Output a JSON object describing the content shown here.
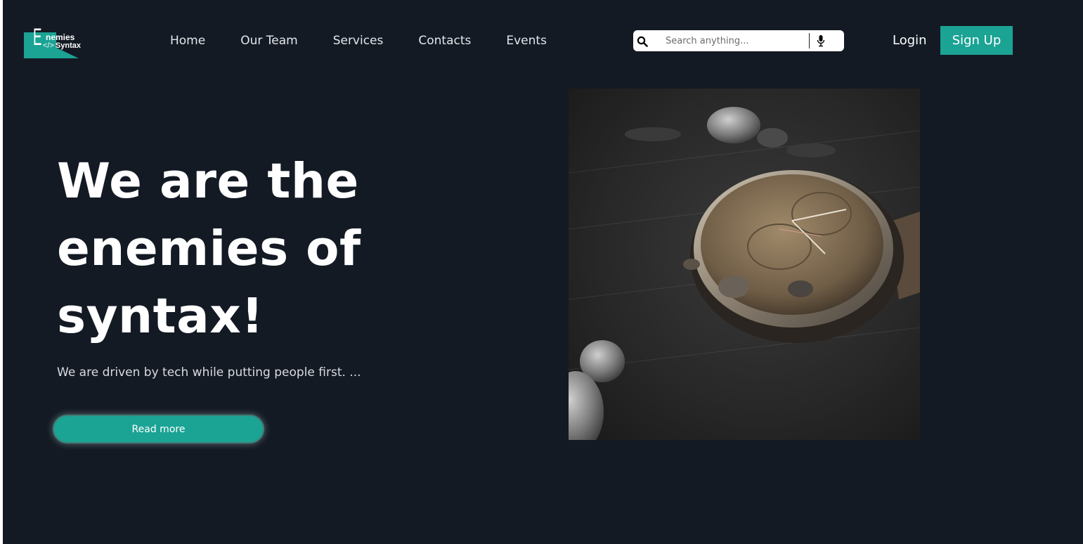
{
  "logo": {
    "big_letter": "E",
    "line1": "nemies",
    "code_glyph": "</>",
    "line2": "Syntax"
  },
  "nav": {
    "items": [
      "Home",
      "Our Team",
      "Services",
      "Contacts",
      "Events"
    ]
  },
  "search": {
    "placeholder": "Search anything...",
    "value": ""
  },
  "auth": {
    "login": "Login",
    "signup": "Sign Up"
  },
  "hero": {
    "title_line1": "We are the",
    "title_line2": "enemies of",
    "title_line3": "syntax!",
    "subtitle": "We are driven by tech while putting people first. ...",
    "cta": "Read more"
  },
  "colors": {
    "background": "#131a24",
    "accent": "#1ba394",
    "text": "#ffffff"
  },
  "icons": [
    "search-icon",
    "mic-icon"
  ]
}
